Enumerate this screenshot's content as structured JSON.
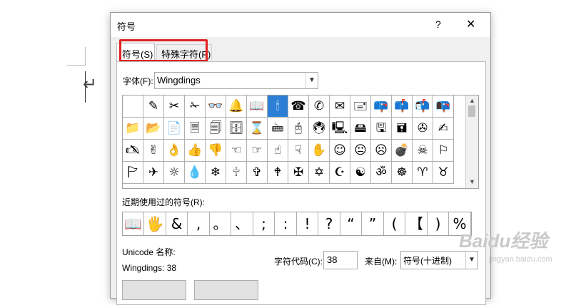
{
  "dialog": {
    "title": "符号",
    "help_label": "?",
    "close_label": "✕"
  },
  "tabs": [
    {
      "label": "符号(S)"
    },
    {
      "label": "特殊字符(P)"
    }
  ],
  "font": {
    "label": "字体(F):",
    "value": "Wingdings"
  },
  "symbol_grid": {
    "selected_index": 7,
    "rows": [
      [
        "",
        "✎",
        "✂",
        "✁",
        "👓",
        "🔔",
        "📖",
        "🕯",
        "☎",
        "✆",
        "✉",
        "🖃",
        "📪",
        "📫",
        "📬",
        "📭"
      ],
      [
        "📁",
        "📂",
        "📄",
        "🗏",
        "🗐",
        "🗄",
        "⌛",
        "🖮",
        "🖰",
        "🖲",
        "🖳",
        "🖴",
        "🖫",
        "🖬",
        "✇",
        "✍"
      ],
      [
        "🖎",
        "✌",
        "👌",
        "👍",
        "👎",
        "☜",
        "☞",
        "☝",
        "☟",
        "✋",
        "☺",
        "😐",
        "☹",
        "💣",
        "☠",
        "⚐"
      ],
      [
        "🏱",
        "✈",
        "☼",
        "💧",
        "❄",
        "🕆",
        "✞",
        "🕈",
        "✠",
        "✡",
        "☪",
        "☯",
        "ॐ",
        "☸",
        "♈",
        "♉"
      ]
    ]
  },
  "recent": {
    "label": "近期使用过的符号(R):",
    "symbols": [
      "📖",
      "🖐",
      "&",
      ",",
      "。",
      "、",
      ";",
      ":",
      "!",
      "?",
      "“",
      "”",
      "(",
      "【",
      ")",
      "%"
    ]
  },
  "unicode_name_label": "Unicode 名称:",
  "symbol_name": "Wingdings: 38",
  "char_code": {
    "label": "字符代码(C):",
    "value": "38"
  },
  "from": {
    "label": "来自(M):",
    "value": "符号(十进制)"
  },
  "watermark": {
    "text": "Baidu经验",
    "sub": "jingyan.baidu.com"
  }
}
